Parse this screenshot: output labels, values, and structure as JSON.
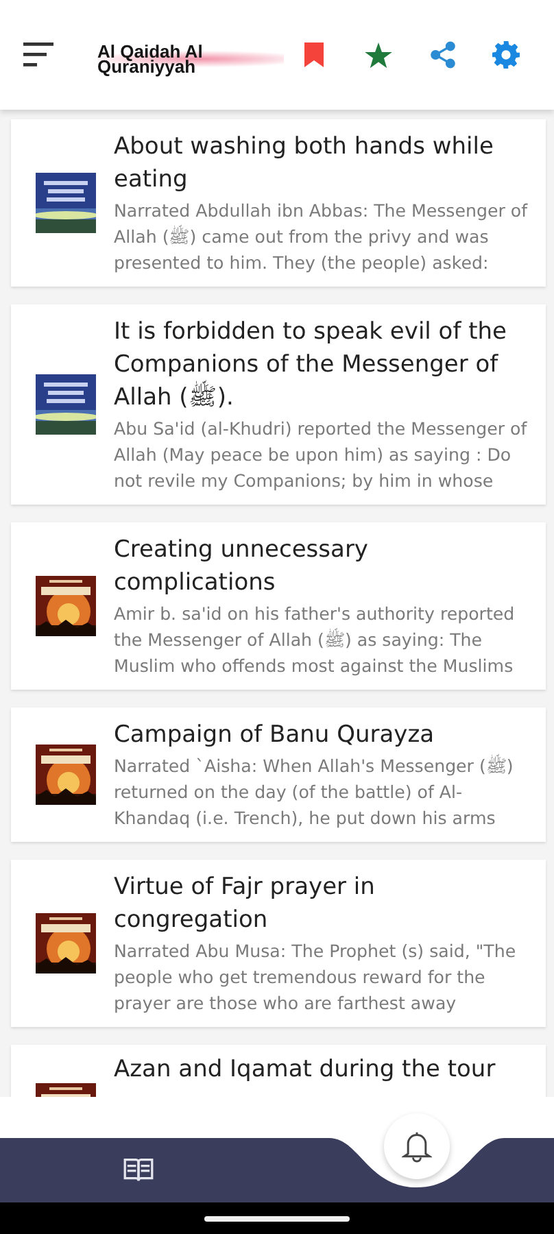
{
  "app_bar": {
    "title": "Al Qaidah Al Quraniyyah"
  },
  "articles": [
    {
      "title": "About washing both hands while eating",
      "excerpt": "Narrated Abdullah ibn Abbas: The Messenger of Allah (ﷺ) came out from the privy and was presented to him. They (the people) asked:"
    },
    {
      "title": "It is forbidden to speak evil of the Companions of the Messenger of Allah (ﷺ).",
      "excerpt": "Abu Sa'id (al-Khudri) reported the Messenger of Allah (May peace be upon him) as saying : Do not revile my Companions; by him in whose"
    },
    {
      "title": "Creating unnecessary complications",
      "excerpt": "Amir b. sa'id on his father's authority reported the Messenger of Allah (ﷺ) as saying: The Muslim who offends most against the Muslims"
    },
    {
      "title": "Campaign of Banu Qurayza",
      "excerpt": "Narrated `Aisha: When Allah's Messenger (ﷺ) returned on the day (of the battle) of Al-Khandaq (i.e. Trench), he put down his arms"
    },
    {
      "title": " Virtue of Fajr prayer in congregation",
      "excerpt": "Narrated Abu Musa: The Prophet (s) said, \"The people who get tremendous reward for the prayer are those who are farthest away"
    },
    {
      "title": "Azan and Iqamat during the tour"
    }
  ]
}
